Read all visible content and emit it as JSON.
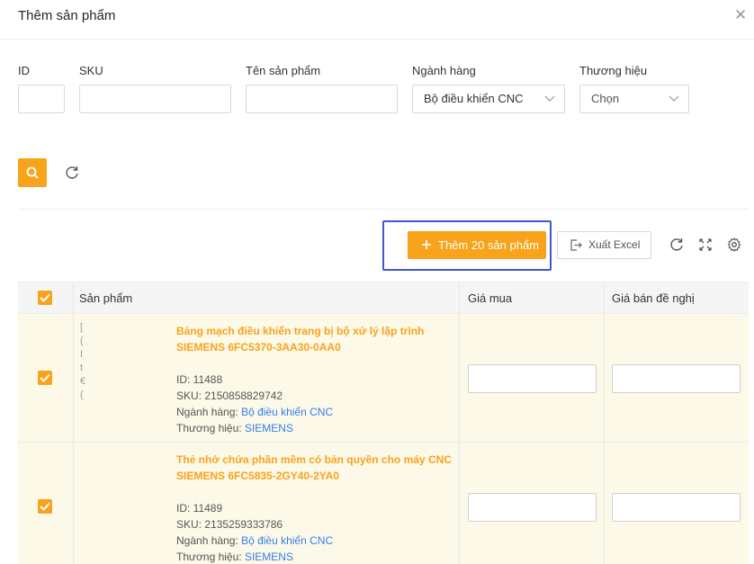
{
  "dialog": {
    "title": "Thêm sản phẩm"
  },
  "filters": {
    "id_label": "ID",
    "sku_label": "SKU",
    "name_label": "Tên sản phẩm",
    "category_label": "Ngành hàng",
    "category_value": "Bộ điều khiển CNC",
    "brand_label": "Thương hiệu",
    "brand_value": "Chọn"
  },
  "toolbar": {
    "add_label": "Thêm 20 sản phẩm",
    "export_label": "Xuất Excel"
  },
  "table": {
    "columns": [
      "Sản phẩm",
      "Giá mua",
      "Giá bán đề nghị"
    ],
    "rows": [
      {
        "name": "Bảng mạch điều khiển trang bị bộ xử lý lập trình SIEMENS 6FC5370-3AA30-0AA0",
        "id_text": "ID: 11488",
        "sku_text": "SKU: 2150858829742",
        "category_prefix": "Ngành hàng: ",
        "category": "Bộ điều khiển CNC",
        "brand_prefix": "Thương hiệu: ",
        "brand": "SIEMENS",
        "checked": true
      },
      {
        "name": "Thẻ nhớ chứa phần mềm có bản quyền cho máy CNC SIEMENS 6FC5835-2GY40-2YA0",
        "id_text": "ID: 11489",
        "sku_text": "SKU: 2135259333786",
        "category_prefix": "Ngành hàng: ",
        "category": "Bộ điều khiển CNC",
        "brand_prefix": "Thương hiệu: ",
        "brand": "SIEMENS",
        "checked": true
      }
    ]
  },
  "image_fragments": [
    "[",
    "(",
    "I",
    "t",
    "€",
    "("
  ],
  "colors": {
    "accent": "#f7a31c",
    "link": "#2f80ed",
    "highlight": "#4355d4"
  }
}
